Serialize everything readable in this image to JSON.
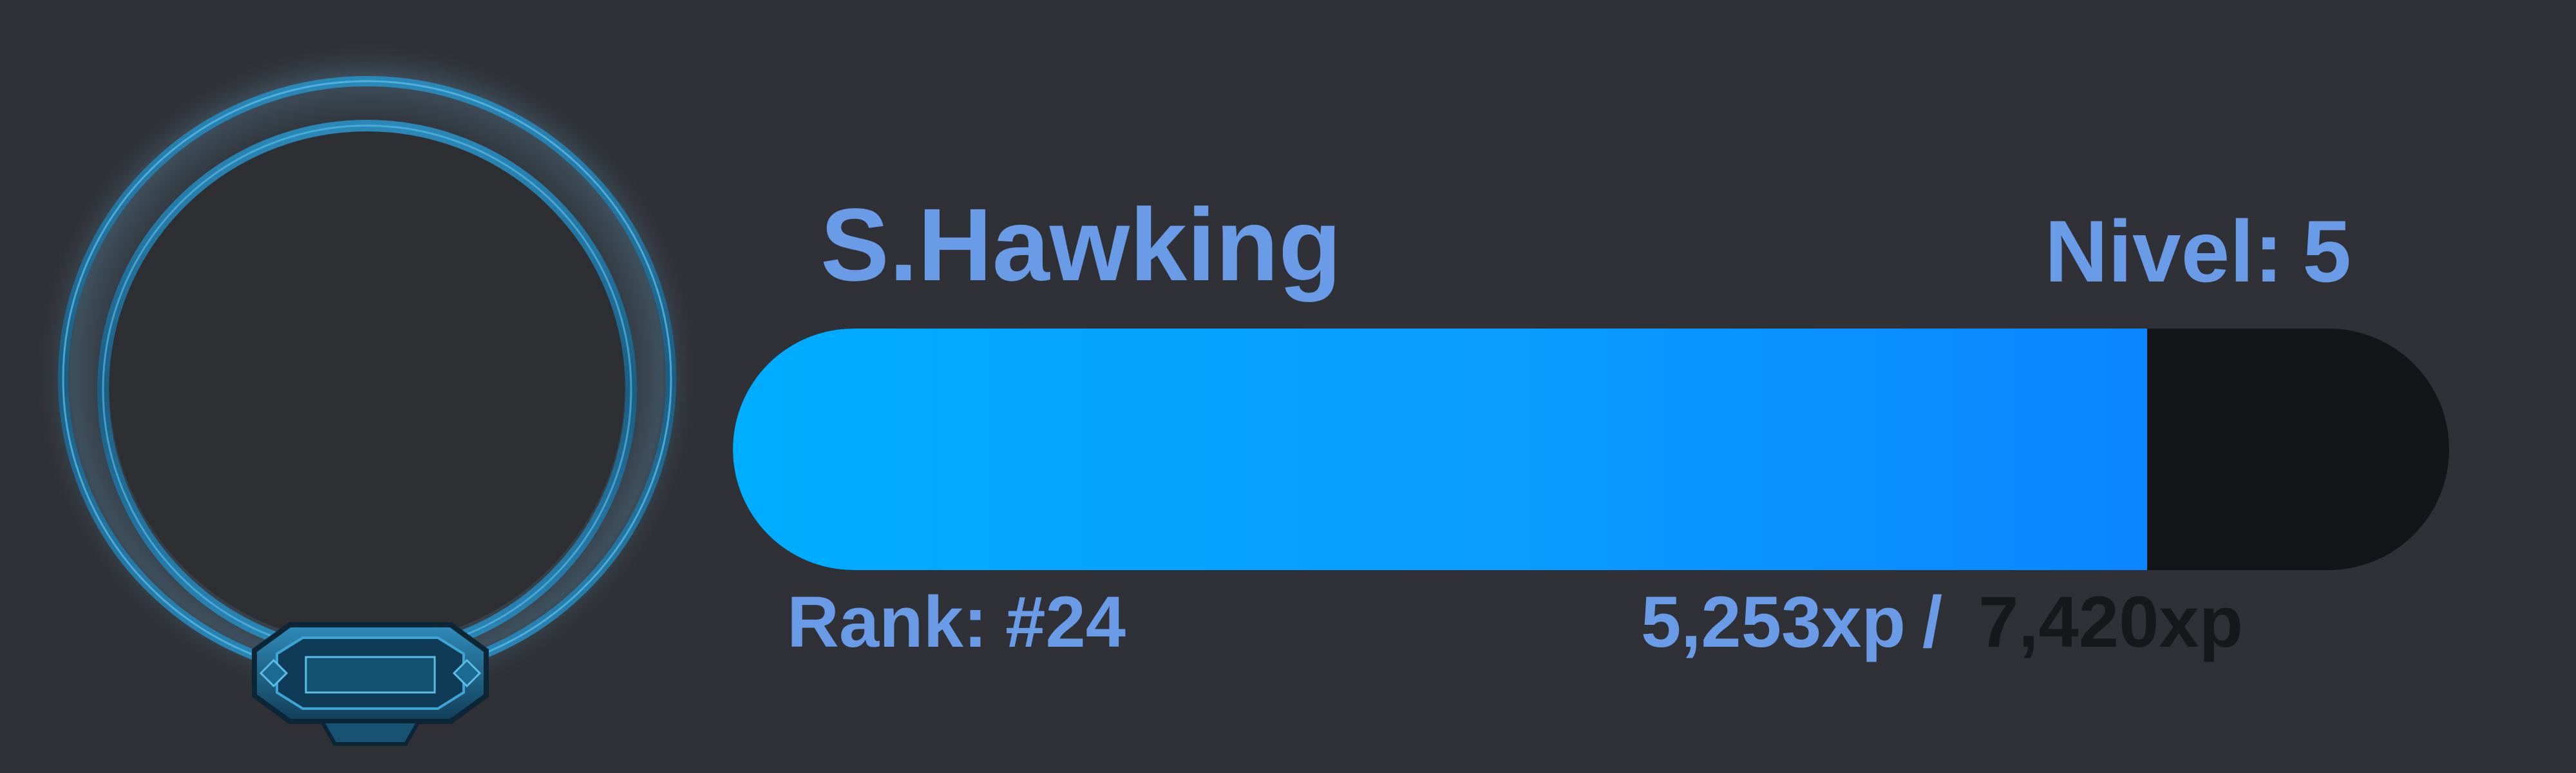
{
  "user": {
    "name": "S.Hawking"
  },
  "level": {
    "label": "Nivel:",
    "value": "5"
  },
  "rank": {
    "label": "Rank:",
    "value": "#24"
  },
  "xp": {
    "current_text": "5,253xp",
    "separator": "/",
    "total_text": "7,420xp",
    "progress": 0.824
  },
  "colors": {
    "background": "#2f3136",
    "text_accent": "#6a9be6",
    "bar_fill_start": "#00adff",
    "bar_fill_end": "#0a86ff",
    "bar_track": "#141518",
    "total_xp_text": "#17181b",
    "frame_ring": "#1f6f9a"
  },
  "icons": {
    "avatar_frame": "ring-frame-icon"
  }
}
